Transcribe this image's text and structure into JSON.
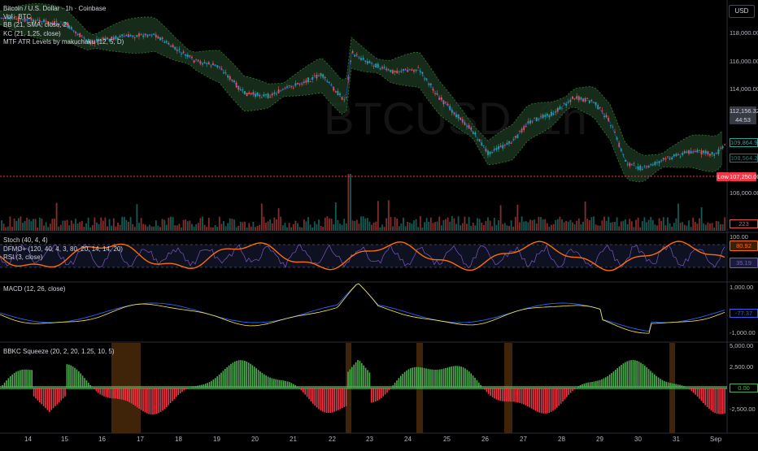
{
  "legend": {
    "main": [
      "Bitcoin / U.S. Dollar · 1h · Coinbase",
      "Vol · BTC",
      "BB (21, SMA, close, 2)",
      "KC (21, 1.25, close)",
      "MTF ATR Levels by makuchaku (12, 5, D)"
    ],
    "osc": [
      "Stoch (40, 4, 4)",
      "DFMO+ (120, 40, 4, 3, 80, 20, 14, 14, 20)",
      "RSI (3, close)"
    ],
    "macd": "MACD (12, 26, close)",
    "squeeze": "BBKC Squeeze (20, 2, 20, 1.25, 10, 5)"
  },
  "watermark": "BTCUSD, 1h",
  "currency_button": "USD",
  "price_axis": {
    "labels": [
      "118,000.00",
      "116,000.00",
      "114,000.00",
      "106,000.00"
    ],
    "current_price": "112,156.32",
    "countdown": "44:53",
    "level1": "109,864.91",
    "level2": "108,564.22",
    "low_label": "Low",
    "low_value": "107,250.00",
    "volume_tag": "223"
  },
  "osc_axis": {
    "top": "100.00",
    "value1": "80.92",
    "value2": "35.19"
  },
  "macd_axis": {
    "top": "1,000.00",
    "value": "-77.37",
    "bottom": "-1,000.00"
  },
  "squeeze_axis": {
    "labels": [
      "5,000.00",
      "2,500.00",
      "-2,500.00"
    ],
    "value": "0.00"
  },
  "time_axis": [
    "14",
    "15",
    "16",
    "17",
    "18",
    "19",
    "20",
    "21",
    "22",
    "23",
    "24",
    "25",
    "26",
    "27",
    "28",
    "29",
    "30",
    "31",
    "Sep"
  ],
  "colors": {
    "up": "#26a69a",
    "down": "#ef5350",
    "cloud": "#1b3320",
    "macd": "#2962ff",
    "signal": "#ffeb3b",
    "stoch": "#ff6d00",
    "rsi": "#7e57c2",
    "squeeze_up": "#4caf50",
    "squeeze_down": "#f23645",
    "highlight": "#4a2a0a",
    "low_line": "#f23645"
  }
}
